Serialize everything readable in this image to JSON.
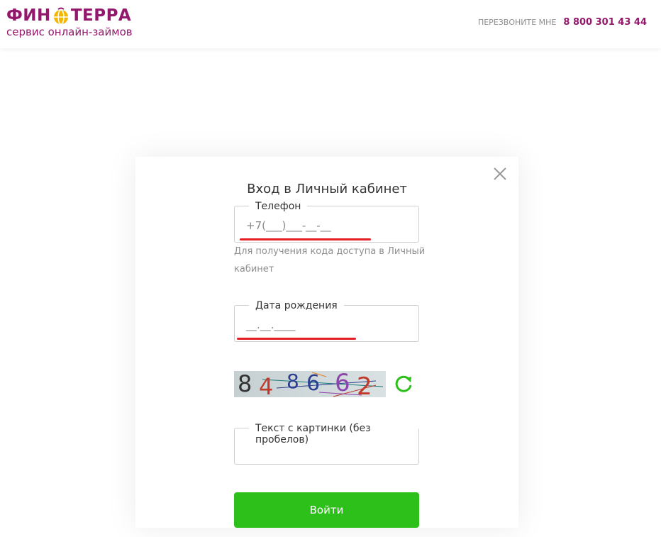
{
  "header": {
    "logo_left": "ФИН",
    "logo_right": "ТЕРРА",
    "logo_sub": "сервис онлайн-займов",
    "callme_label": "ПЕРЕЗВОНИТЕ МНЕ",
    "phone": "8 800 301 43 44"
  },
  "modal": {
    "title": "Вход в Личный кабинет",
    "phone_field": {
      "legend": "Телефон",
      "value": "+7(___)___-__-__"
    },
    "phone_hint": "Для получения кода доступа в Личный кабинет",
    "birth_field": {
      "legend": "Дата рождения",
      "value": "__.__.____"
    },
    "captcha": {
      "digits": [
        "8",
        "4",
        "8",
        "6",
        "6",
        "2"
      ],
      "colors": [
        "#333333",
        "#c0392b",
        "#2c3e8f",
        "#2c3e8f",
        "#8e44ad",
        "#c0392b"
      ]
    },
    "captcha_field": {
      "legend": "Текст с картинки (без пробелов)",
      "value": ""
    },
    "submit_label": "Войти"
  },
  "colors": {
    "brand": "#93186c",
    "accent": "#2dbf1a",
    "annotation": "#e31e24"
  },
  "icons": {
    "close": "close-icon",
    "refresh": "refresh-icon",
    "arrow": "arrow-right-icon"
  }
}
